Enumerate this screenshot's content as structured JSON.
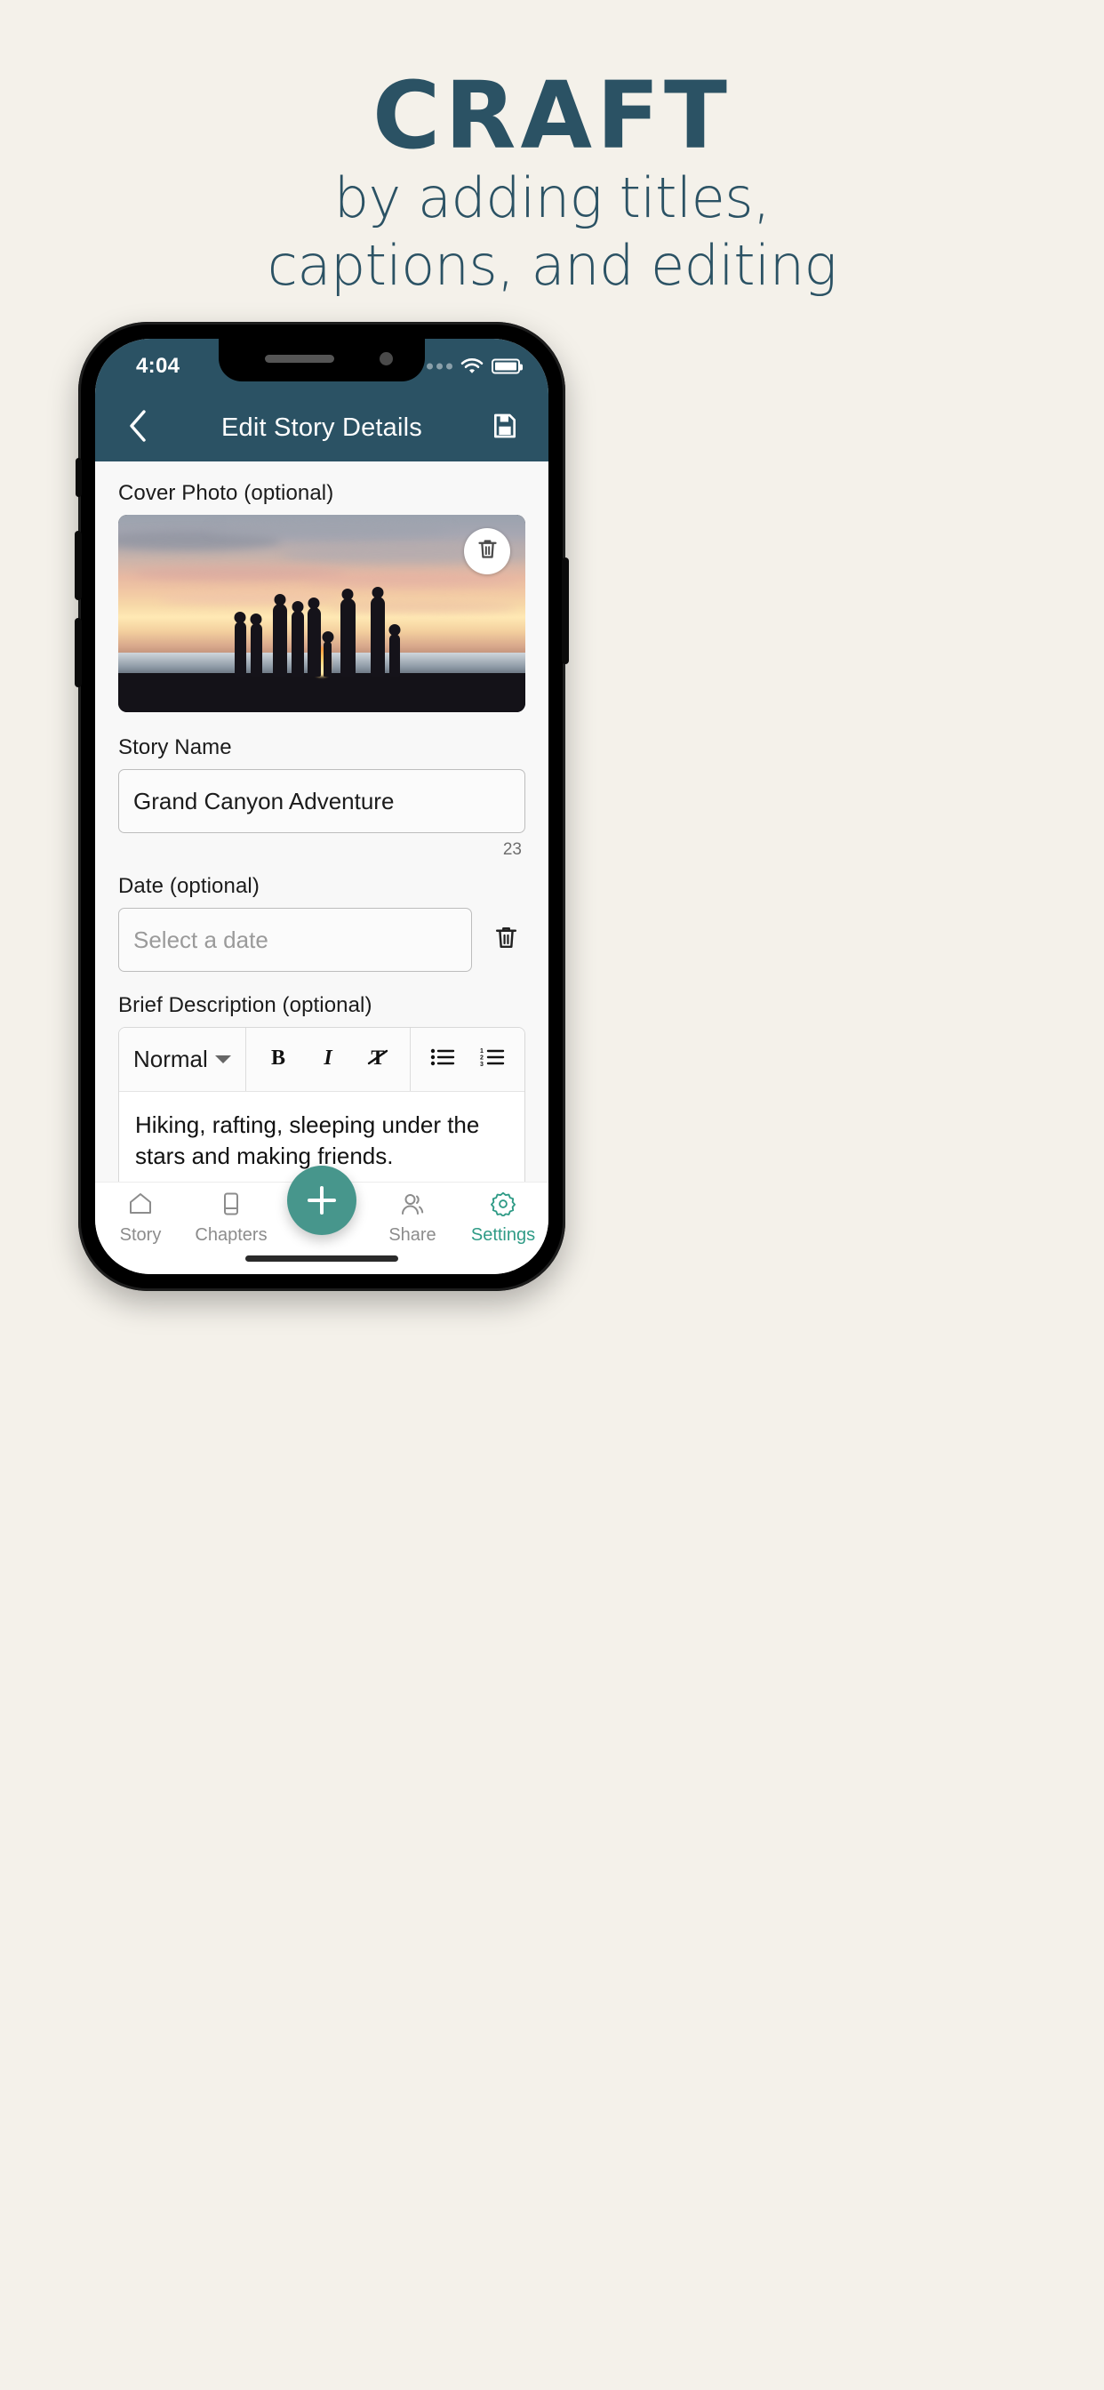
{
  "marketing": {
    "headline": "CRAFT",
    "subhead_line1": "by adding titles,",
    "subhead_line2": "captions, and editing"
  },
  "theme": {
    "page_bg": "#f4f1ea",
    "brand_dark": "#2b5264",
    "accent_teal": "#47968c",
    "active_nav": "#2f9b86"
  },
  "status_bar": {
    "time": "4:04",
    "wifi_icon": "wifi-icon",
    "battery_icon": "battery-full-icon",
    "signal_icon": "signal-dots-icon"
  },
  "app_bar": {
    "back_icon": "chevron-left-icon",
    "title": "Edit Story Details",
    "save_icon": "floppy-disk-save-icon"
  },
  "form": {
    "cover_photo": {
      "label": "Cover Photo (optional)",
      "delete_icon": "trash-icon",
      "alt": "Silhouettes of people around a beach bonfire at sunset"
    },
    "story_name": {
      "label": "Story Name",
      "value": "Grand Canyon Adventure",
      "char_count": "23"
    },
    "date": {
      "label": "Date (optional)",
      "placeholder": "Select a date",
      "value": "",
      "delete_icon": "trash-icon"
    },
    "description": {
      "label": "Brief Description (optional)",
      "toolbar": {
        "style_select": "Normal",
        "style_caret_icon": "chevron-down-icon",
        "bold_icon": "bold-icon",
        "bold_label": "B",
        "italic_icon": "italic-icon",
        "italic_label": "I",
        "clear_format_icon": "clear-formatting-icon",
        "bullet_list_icon": "bullet-list-icon",
        "numbered_list_icon": "numbered-list-icon"
      },
      "value": "Hiking, rafting, sleeping under the stars and making friends.",
      "resize_handle_icon": "resize-handle-icon"
    }
  },
  "bottom_nav": {
    "items": [
      {
        "label": "Story",
        "icon": "home-icon",
        "active": false
      },
      {
        "label": "Chapters",
        "icon": "book-icon",
        "active": false
      },
      {
        "label": "Share",
        "icon": "people-icon",
        "active": false
      },
      {
        "label": "Settings",
        "icon": "gear-icon",
        "active": true
      }
    ],
    "fab": {
      "icon": "plus-icon",
      "label": "+"
    }
  }
}
